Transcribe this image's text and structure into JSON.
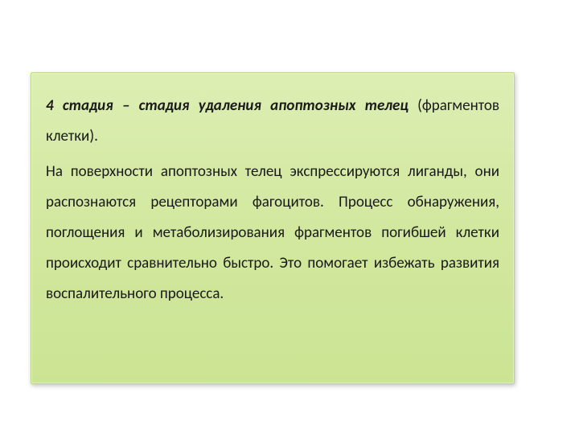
{
  "slide": {
    "title_bold": "4 стадия – стадия удаления апоптозных телец",
    "title_rest": " (фрагментов клетки).",
    "body": "На поверхности апоптозных телец экспрессируются лиганды, они распознаются рецепторами фагоцитов. Процесс обнаружения, поглощения и метаболизирования фрагментов погибшей клетки происходит сравнительно быстро. Это помогает избежать развития воспалительного процесса."
  }
}
